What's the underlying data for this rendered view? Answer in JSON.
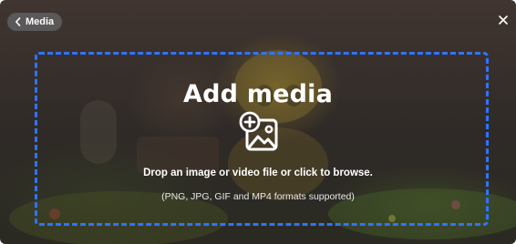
{
  "header": {
    "back_label": "Media",
    "back_icon": "chevron-left-icon",
    "close_icon": "close-icon"
  },
  "drop_zone": {
    "title": "Add media",
    "icon": "add-image-icon",
    "instruction": "Drop an image or video file or click to browse.",
    "formats_note": "(PNG, JPG, GIF and MP4 formats supported)",
    "border_color": "#2f74ff"
  }
}
